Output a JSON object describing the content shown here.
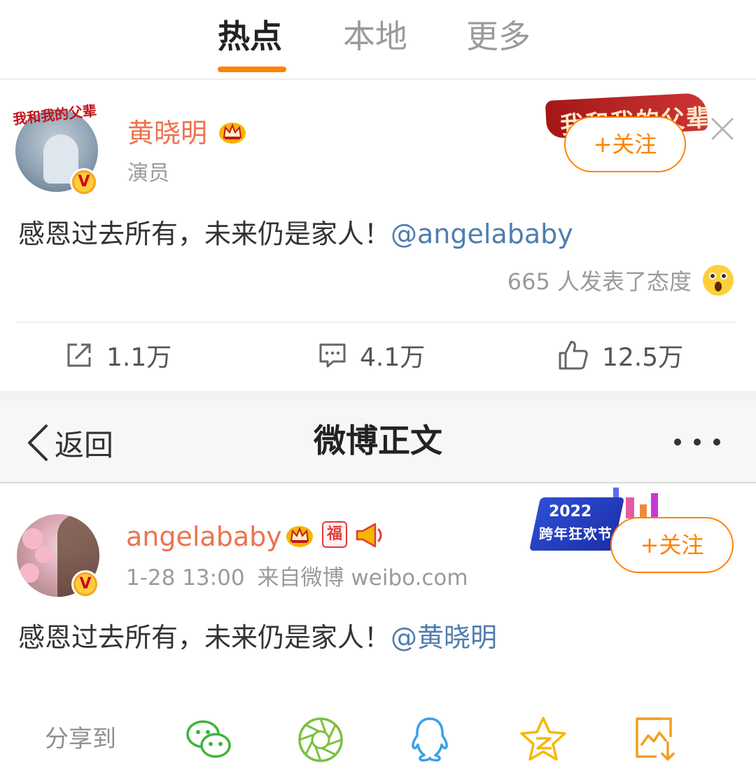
{
  "tabs": [
    {
      "label": "热点",
      "active": true
    },
    {
      "label": "本地",
      "active": false
    },
    {
      "label": "更多",
      "active": false
    }
  ],
  "accent_color": "#ff8200",
  "name_color": "#eb7350",
  "mention_color": "#507daf",
  "post1": {
    "author": "黄晓明",
    "author_title": "演员",
    "avatar_art_text": "我和我的父辈",
    "banner_text": "我和我的父辈",
    "follow_label": "+关注",
    "text": "感恩过去所有，未来仍是家人！",
    "mention": "@angelababy",
    "reaction_summary": "665 人发表了态度",
    "reaction_icon": "surprised-face-icon",
    "actions": {
      "repost": "1.1万",
      "comment": "4.1万",
      "like": "12.5万"
    }
  },
  "navbar": {
    "back_label": "返回",
    "title": "微博正文"
  },
  "post2": {
    "author": "angelababy",
    "badge_fu": "福",
    "time": "1-28 13:00",
    "source": "来自微博 weibo.com",
    "follow_label": "+关注",
    "promo_year": "2022",
    "promo_text": "跨年狂欢节",
    "text": "感恩过去所有，未来仍是家人！",
    "mention": "@黄晓明"
  },
  "share": {
    "label": "分享到",
    "targets": [
      "wechat-icon",
      "moments-icon",
      "qq-icon",
      "qzone-icon",
      "save-image-icon"
    ]
  }
}
